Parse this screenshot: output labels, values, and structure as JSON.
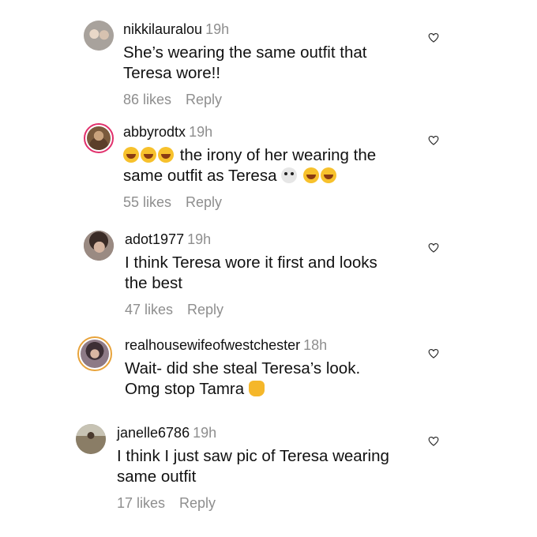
{
  "comments": [
    {
      "username": "nikkilauralou",
      "time": "19h",
      "lines": [
        "She’s wearing the same outfit that",
        "Teresa wore!!"
      ],
      "likes": "86 likes",
      "reply": "Reply",
      "avatar_color": "#b8b2ad",
      "has_story_ring": false
    },
    {
      "username": "abbyrodtx",
      "time": "19h",
      "lines": [
        "the irony of her wearing the",
        "same outfit as Teresa"
      ],
      "likes": "55 likes",
      "reply": "Reply",
      "avatar_color": "#7a5a3d",
      "has_story_ring": true
    },
    {
      "username": "adot1977",
      "time": "19h",
      "lines": [
        "I think Teresa wore it first and looks",
        "the best"
      ],
      "likes": "47 likes",
      "reply": "Reply",
      "avatar_color": "#6e5c55",
      "has_story_ring": false
    },
    {
      "username": "realhousewifeofwestchester",
      "time": "18h",
      "lines": [
        "Wait- did she steal Teresa’s look.",
        "Omg stop Tamra"
      ],
      "likes": "",
      "reply": "",
      "avatar_color": "#8d7a86",
      "has_story_ring": true
    },
    {
      "username": "janelle6786",
      "time": "19h",
      "lines": [
        "I think I just saw pic of Teresa wearing",
        "same outfit"
      ],
      "likes": "17 likes",
      "reply": "Reply",
      "avatar_color": "#8c8a76",
      "has_story_ring": false
    }
  ],
  "colors": {
    "secondary_text": "#8e8e8e",
    "story_ring": "#e1306c",
    "emoji_yellow": "#f7c12c"
  },
  "icons": {
    "like": "heart-outline-icon",
    "emoji_laugh": "rolling-on-floor-laughing-emoji",
    "emoji_skull": "skull-emoji",
    "emoji_hand": "raised-hand-emoji"
  }
}
